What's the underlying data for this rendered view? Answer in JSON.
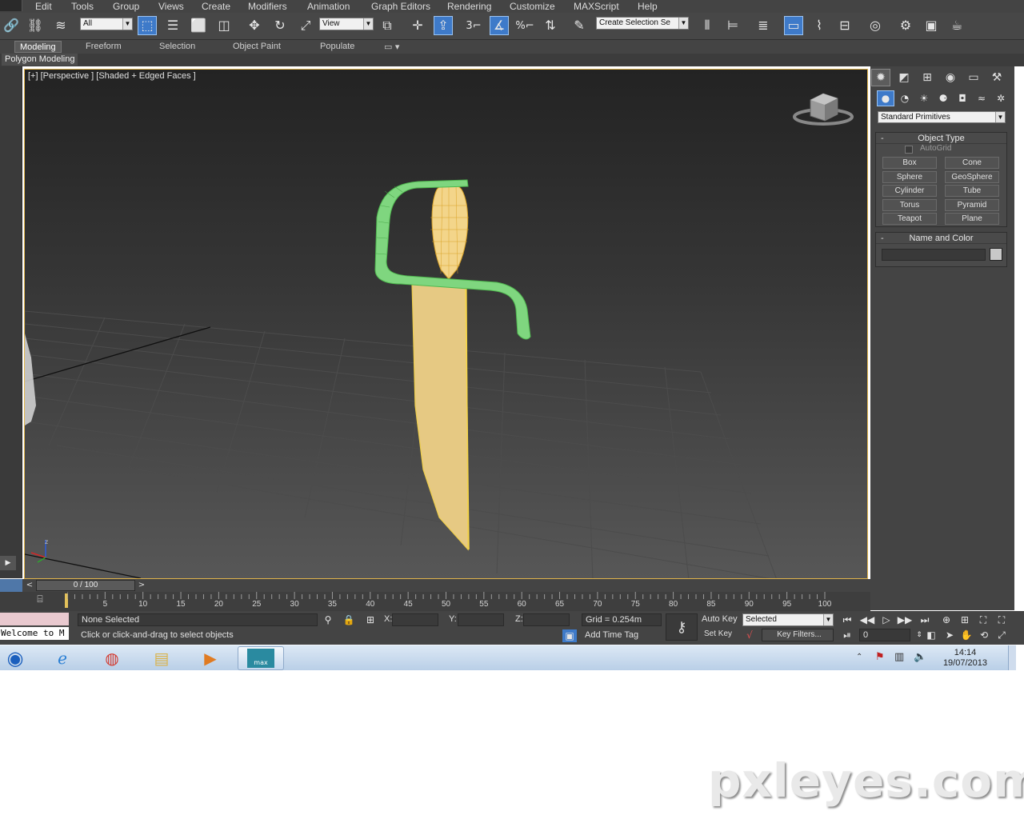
{
  "menubar": {
    "items": [
      "Edit",
      "Tools",
      "Group",
      "Views",
      "Create",
      "Modifiers",
      "Animation",
      "Graph Editors",
      "Rendering",
      "Customize",
      "MAXScript",
      "Help"
    ]
  },
  "toolbar": {
    "selection_filter": "All",
    "reference_coord": "View",
    "named_selection": "Create Selection Se",
    "snap_label": "3",
    "percent_snap": "%"
  },
  "ribbon": {
    "tabs": [
      "Modeling",
      "Freeform",
      "Selection",
      "Object Paint",
      "Populate"
    ],
    "active_tab": "Modeling",
    "sub_label": "Polygon Modeling"
  },
  "viewport": {
    "label": "[+] [Perspective ] [Shaded + Edged Faces ]",
    "frame_color": "#e0b44a",
    "guard_color": "#7fd67f",
    "blade_color": "#e6c983"
  },
  "command_panel": {
    "category_dropdown": "Standard Primitives",
    "object_type": {
      "title": "Object Type",
      "autogrid": "AutoGrid",
      "buttons": [
        "Box",
        "Cone",
        "Sphere",
        "GeoSphere",
        "Cylinder",
        "Tube",
        "Torus",
        "Pyramid",
        "Teapot",
        "Plane"
      ]
    },
    "name_and_color": {
      "title": "Name and Color",
      "name_value": ""
    }
  },
  "timeline": {
    "frame_display": "0 / 100",
    "ticks": [
      "5",
      "10",
      "15",
      "20",
      "25",
      "30",
      "35",
      "40",
      "45",
      "50",
      "55",
      "60",
      "65",
      "70",
      "75",
      "80",
      "85",
      "90",
      "95",
      "100"
    ]
  },
  "status": {
    "maxscript_listener": "Welcome to M",
    "selection_text": "None Selected",
    "prompt_text": "Click or click-and-drag to select objects",
    "x_label": "X:",
    "y_label": "Y:",
    "z_label": "Z:",
    "grid_text": "Grid = 0.254m",
    "add_time_tag": "Add Time Tag",
    "auto_key": "Auto Key",
    "set_key": "Set Key",
    "key_mode": "Selected",
    "key_filters": "Key Filters...",
    "current_frame": "0"
  },
  "taskbar": {
    "time": "14:14",
    "date": "19/07/2013",
    "active_app": "max"
  },
  "watermark": "pxleyes.com"
}
